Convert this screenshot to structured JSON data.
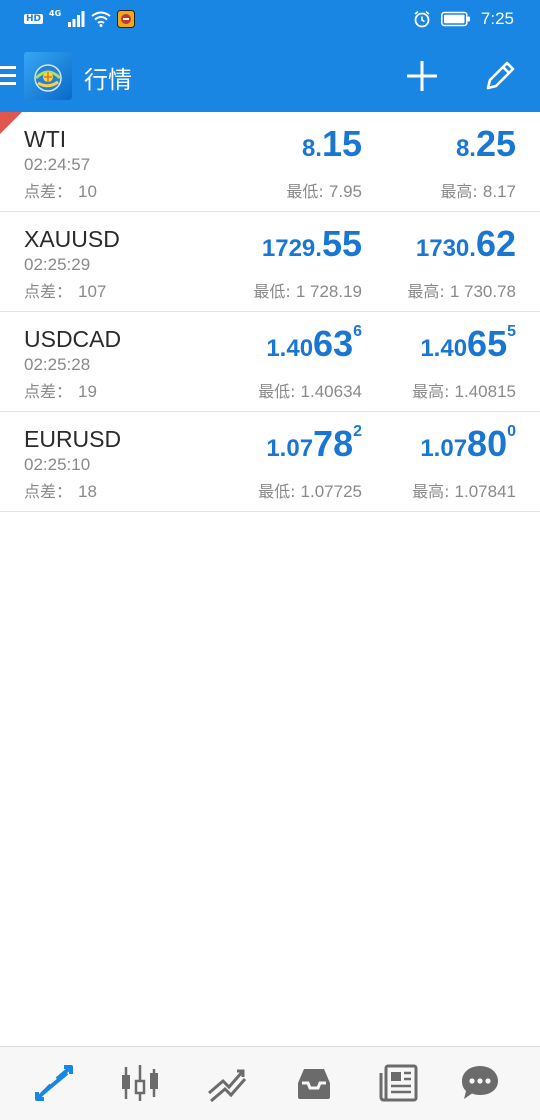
{
  "status_bar": {
    "network_hd": "HD",
    "network_type": "4G",
    "time": "7:25",
    "icons": [
      "signal-icon",
      "wifi-icon",
      "app-notification-icon",
      "alarm-icon",
      "battery-icon"
    ]
  },
  "app_bar": {
    "title": "行情",
    "icons": [
      "menu-icon",
      "metatrader-logo",
      "add-icon",
      "edit-icon"
    ]
  },
  "labels": {
    "spread": "点差：",
    "low": "最低: ",
    "high": "最高: "
  },
  "quotes": [
    {
      "symbol": "WTI",
      "time": "02:24:57",
      "spread": "10",
      "bid": {
        "small": "8.",
        "big": "15",
        "sup": ""
      },
      "ask": {
        "small": "8.",
        "big": "25",
        "sup": ""
      },
      "low": "7.95",
      "high": "8.17"
    },
    {
      "symbol": "XAUUSD",
      "time": "02:25:29",
      "spread": "107",
      "bid": {
        "small": "1729.",
        "big": "55",
        "sup": ""
      },
      "ask": {
        "small": "1730.",
        "big": "62",
        "sup": ""
      },
      "low": "1 728.19",
      "high": "1 730.78"
    },
    {
      "symbol": "USDCAD",
      "time": "02:25:28",
      "spread": "19",
      "bid": {
        "small": "1.40",
        "big": "63",
        "sup": "6"
      },
      "ask": {
        "small": "1.40",
        "big": "65",
        "sup": "5"
      },
      "low": "1.40634",
      "high": "1.40815"
    },
    {
      "symbol": "EURUSD",
      "time": "02:25:10",
      "spread": "18",
      "bid": {
        "small": "1.07",
        "big": "78",
        "sup": "2"
      },
      "ask": {
        "small": "1.07",
        "big": "80",
        "sup": "0"
      },
      "low": "1.07725",
      "high": "1.07841"
    }
  ],
  "bottom_nav": {
    "items": [
      "quotes-icon",
      "chart-candles-icon",
      "trade-icon",
      "history-inbox-icon",
      "news-icon",
      "chat-icon"
    ],
    "active_index": 0,
    "colors": {
      "active": "#1a86e3",
      "inactive": "#6b6b6b"
    }
  },
  "colors": {
    "brand": "#1a86e3",
    "price": "#1976d2",
    "muted": "#8a8a8a",
    "corner_marker": "#e0574f"
  }
}
